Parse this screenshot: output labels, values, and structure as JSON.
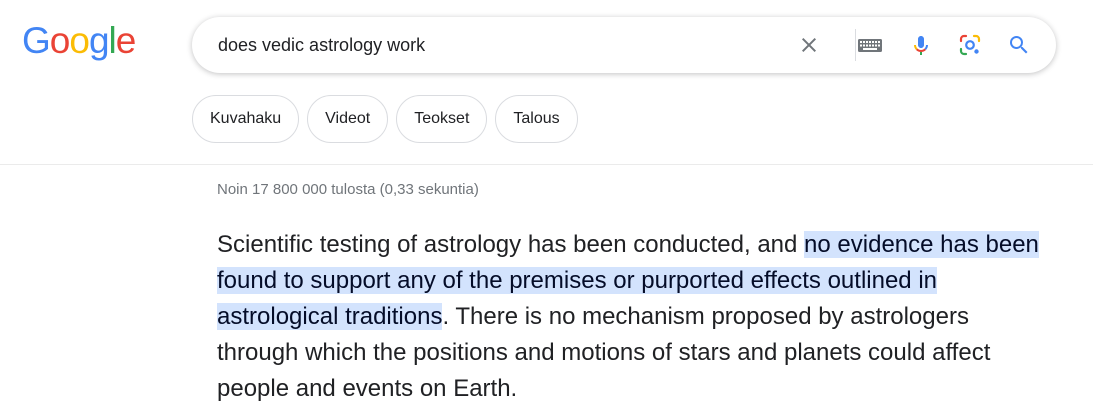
{
  "logo": {
    "letters": [
      "G",
      "o",
      "o",
      "g",
      "l",
      "e"
    ],
    "colors": [
      "#4285F4",
      "#EA4335",
      "#FBBC05",
      "#4285F4",
      "#34A853",
      "#EA4335"
    ]
  },
  "search": {
    "query": "does vedic astrology work",
    "icons": [
      "close-icon",
      "keyboard-icon",
      "microphone-icon",
      "lens-icon",
      "search-icon"
    ]
  },
  "chips": [
    {
      "label": "Kuvahaku"
    },
    {
      "label": "Videot"
    },
    {
      "label": "Teokset"
    },
    {
      "label": "Talous"
    }
  ],
  "results": {
    "stats": "Noin 17 800 000 tulosta (0,33 sekuntia)"
  },
  "featured_snippet": {
    "text_before": "Scientific testing of astrology has been conducted, and ",
    "highlighted": "no evidence has been found to support any of the premises or purported effects outlined in astrological traditions",
    "text_after": ". There is no mechanism proposed by astrologers through which the positions and motions of stars and planets could affect people and events on Earth."
  },
  "colors": {
    "highlight": "#d3e3fd",
    "accent_blue": "#4285F4",
    "text": "#202124",
    "muted": "#70757a"
  }
}
